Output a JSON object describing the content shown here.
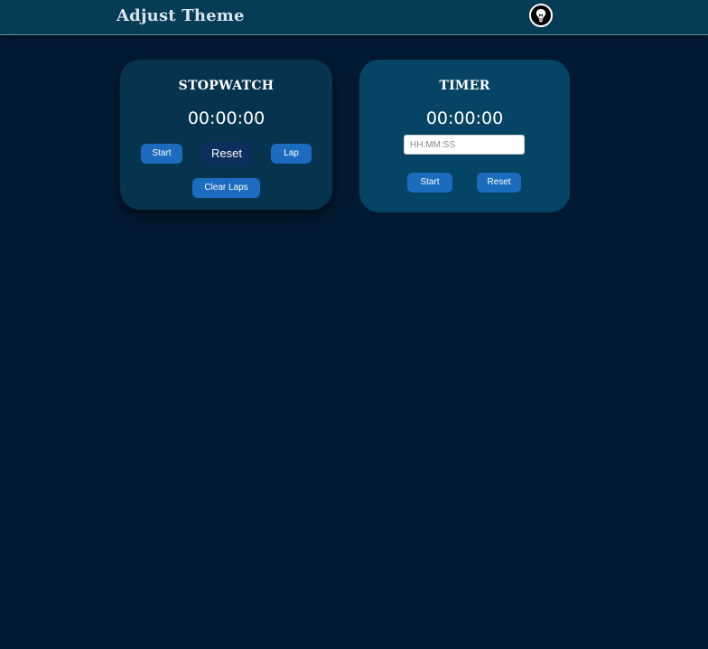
{
  "header": {
    "title": "Adjust Theme",
    "toggle_icon": "lightbulb-icon"
  },
  "stopwatch": {
    "title": "STOPWATCH",
    "time": "00:00:00",
    "start_label": "Start",
    "reset_label": "Reset",
    "lap_label": "Lap",
    "clear_laps_label": "Clear Laps"
  },
  "timer": {
    "title": "TIMER",
    "time": "00:00:00",
    "input_value": "",
    "input_placeholder": "HH:MM:SS",
    "start_label": "Start",
    "reset_label": "Reset"
  },
  "colors": {
    "page_background": "#021a31",
    "header_background": "#063c56",
    "stopwatch_card": "#06344f",
    "timer_card": "#064466",
    "button": "#1b6bbf",
    "button_dark": "#0c2f5e",
    "text": "#ffffff"
  }
}
